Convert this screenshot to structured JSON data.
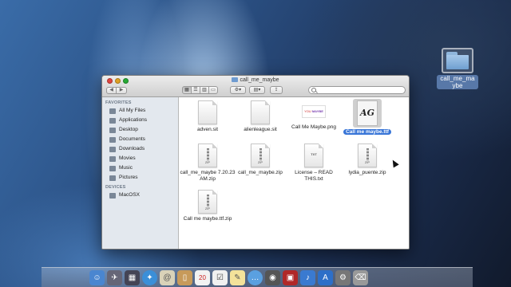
{
  "desktop": {
    "folder_label": "call_me_maybe"
  },
  "window": {
    "title": "call_me_maybe",
    "search_placeholder": ""
  },
  "sidebar": {
    "favorites_header": "FAVORITES",
    "favorites": [
      {
        "label": "All My Files",
        "icon": "all-files-icon"
      },
      {
        "label": "Applications",
        "icon": "applications-icon"
      },
      {
        "label": "Desktop",
        "icon": "desktop-icon"
      },
      {
        "label": "Documents",
        "icon": "documents-icon"
      },
      {
        "label": "Downloads",
        "icon": "downloads-icon"
      },
      {
        "label": "Movies",
        "icon": "movies-icon"
      },
      {
        "label": "Music",
        "icon": "music-icon"
      },
      {
        "label": "Pictures",
        "icon": "pictures-icon"
      }
    ],
    "devices_header": "DEVICES",
    "devices": [
      {
        "label": "MacOSX",
        "icon": "disk-icon"
      }
    ]
  },
  "files": [
    {
      "name": "adven.sit",
      "kind": "doc"
    },
    {
      "name": "alienleague.sit",
      "kind": "doc"
    },
    {
      "name": "Call Me Maybe.png",
      "kind": "png"
    },
    {
      "name": "Call me maybe.ttf",
      "kind": "font",
      "selected": true
    },
    {
      "name": "call_me_maybe 7.20.23 AM.zip",
      "kind": "zip"
    },
    {
      "name": "call_me_maybe.zip",
      "kind": "zip"
    },
    {
      "name": "License – READ THIS.txt",
      "kind": "txt"
    },
    {
      "name": "lydia_puente.zip",
      "kind": "zip"
    },
    {
      "name": "Call me maybe.ttf.zip",
      "kind": "zip"
    }
  ],
  "icon_tags": {
    "zip": "ZIP",
    "txt": "TXT",
    "font_preview": "AG"
  }
}
